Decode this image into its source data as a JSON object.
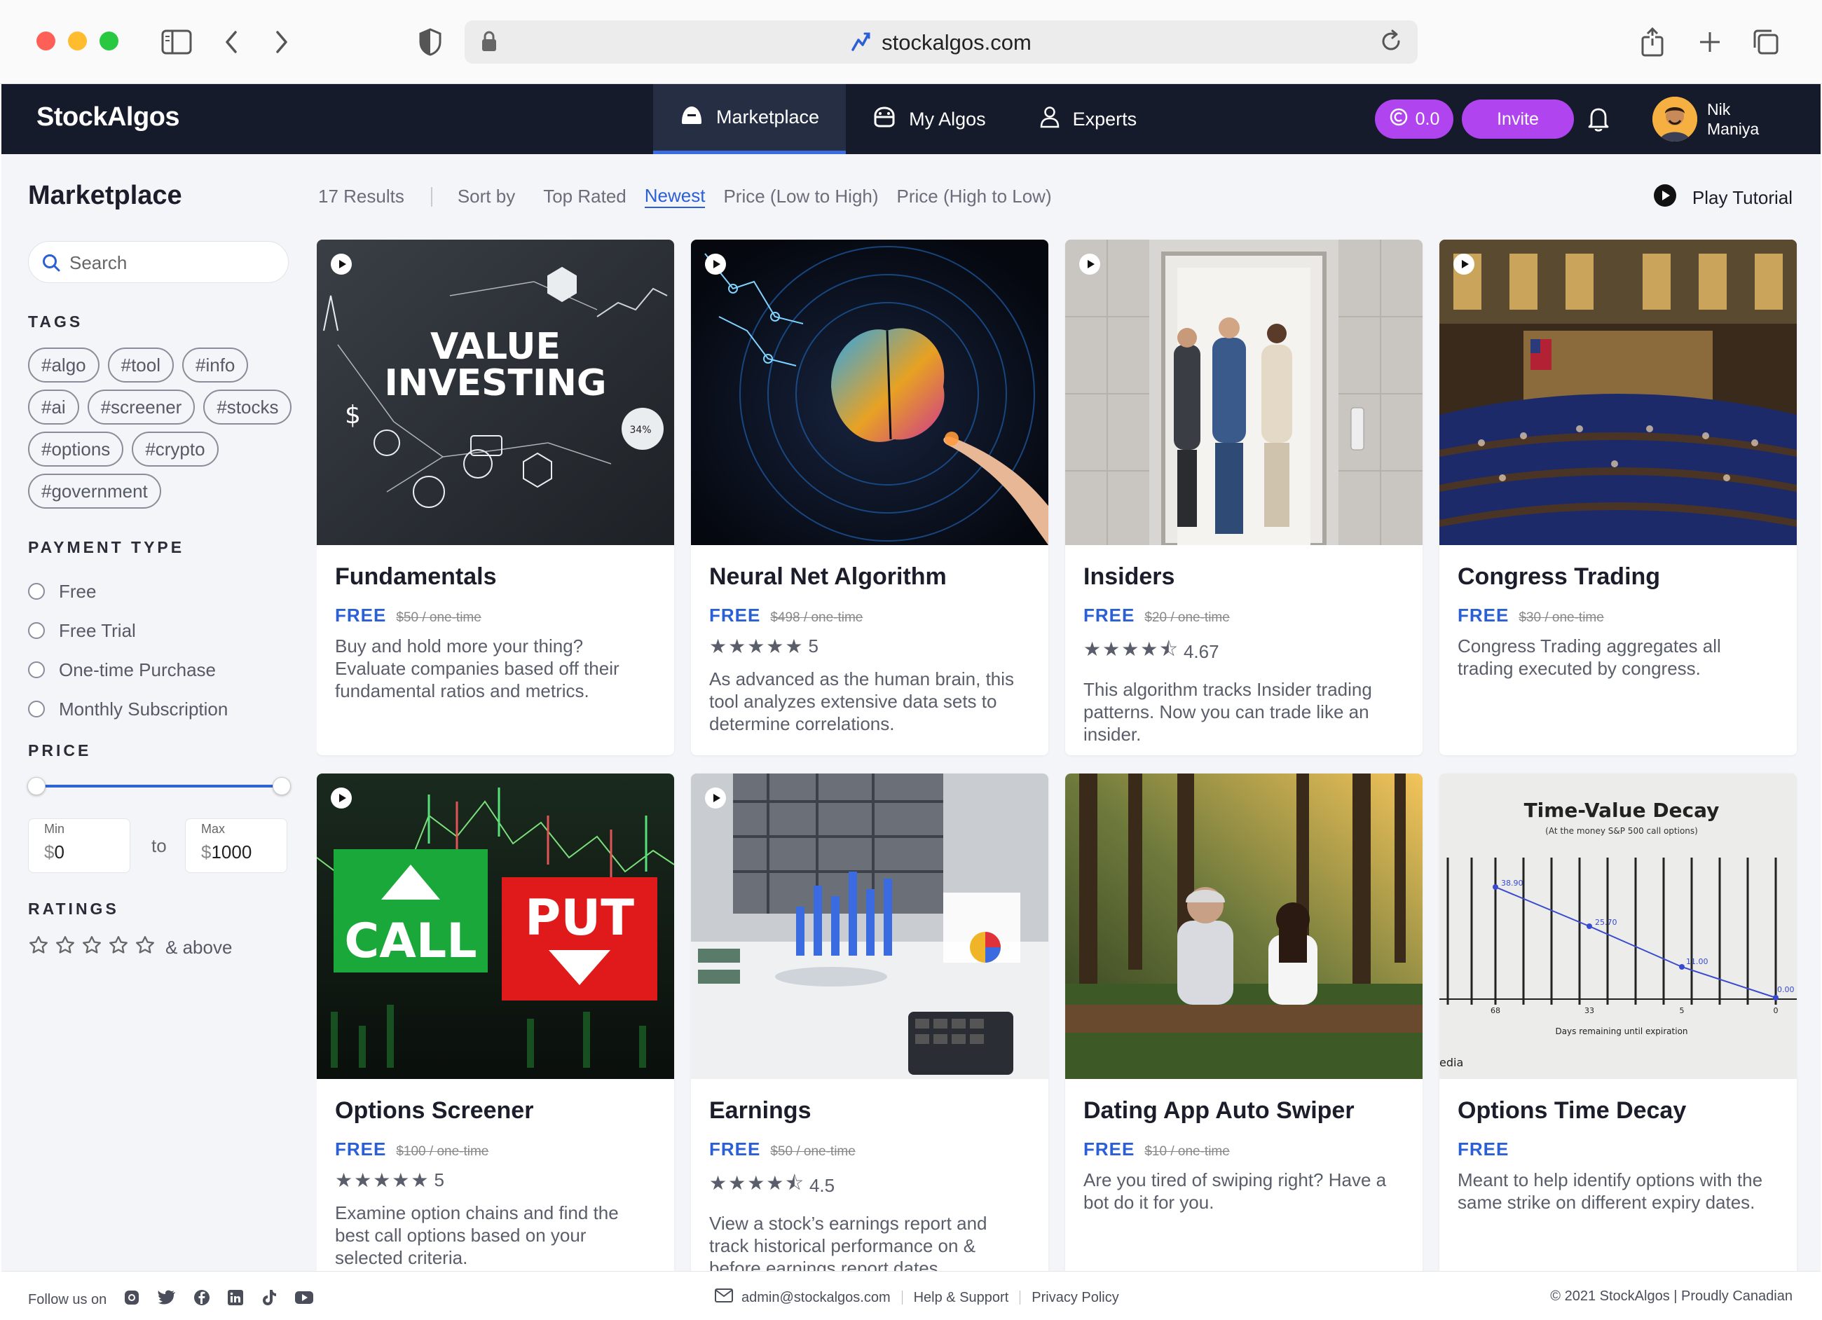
{
  "browser": {
    "url": "stockalgos.com"
  },
  "header": {
    "logo": "StockAlgos",
    "nav": [
      {
        "label": "Marketplace",
        "icon": "marketplace-icon",
        "active": true
      },
      {
        "label": "My Algos",
        "icon": "my-algos-icon",
        "active": false
      },
      {
        "label": "Experts",
        "icon": "user-icon",
        "active": false
      }
    ],
    "credits": "0.0",
    "invite_label": "Invite",
    "user_first": "Nik",
    "user_last": "Maniya"
  },
  "sidebar": {
    "title": "Marketplace",
    "search_placeholder": "Search",
    "tags_label": "TAGS",
    "tags": [
      "#algo",
      "#tool",
      "#info",
      "#ai",
      "#screener",
      "#stocks",
      "#options",
      "#crypto",
      "#government"
    ],
    "payment_label": "PAYMENT TYPE",
    "payment_options": [
      "Free",
      "Free Trial",
      "One-time Purchase",
      "Monthly Subscription"
    ],
    "price_label": "PRICE",
    "price_min_caption": "Min",
    "price_max_caption": "Max",
    "price_currency": "$",
    "price_min": "0",
    "price_max": "1000",
    "price_to": "to",
    "ratings_label": "RATINGS",
    "ratings_suffix": "& above"
  },
  "toolbar": {
    "results": "17 Results",
    "sort_by": "Sort by",
    "sort_options": [
      "Top Rated",
      "Newest",
      "Price (Low to High)",
      "Price (High to Low)"
    ],
    "active_sort": "Newest",
    "tutorial": "Play Tutorial"
  },
  "cards": [
    {
      "title": "Fundamentals",
      "free": "FREE",
      "was": "$50 / one-time",
      "rating": null,
      "rating_text": "",
      "desc": "Buy and hold more your thing? Evaluate companies based off their fundamental ratios and metrics."
    },
    {
      "title": "Neural Net Algorithm",
      "free": "FREE",
      "was": "$498 / one-time",
      "rating": 5,
      "rating_text": "5",
      "desc": "As advanced as the human brain, this tool analyzes extensive data sets to determine correlations."
    },
    {
      "title": "Insiders",
      "free": "FREE",
      "was": "$20 / one-time",
      "rating": 4.67,
      "rating_text": "4.67",
      "desc": "This algorithm tracks Insider trading patterns. Now you can trade like an insider."
    },
    {
      "title": "Congress Trading",
      "free": "FREE",
      "was": "$30 / one-time",
      "rating": null,
      "rating_text": "",
      "desc": "Congress Trading aggregates all trading executed by congress."
    },
    {
      "title": "Options Screener",
      "free": "FREE",
      "was": "$100 / one-time",
      "rating": 5,
      "rating_text": "5",
      "desc": "Examine option chains and find the best call options based on your selected criteria."
    },
    {
      "title": "Earnings",
      "free": "FREE",
      "was": "$50 / one-time",
      "rating": 4.5,
      "rating_text": "4.5",
      "desc": "View a stock’s earnings report and track historical performance on & before earnings report dates."
    },
    {
      "title": "Dating App Auto Swiper",
      "free": "FREE",
      "was": "$10 / one-time",
      "rating": null,
      "rating_text": "",
      "desc": "Are you tired of swiping right? Have a bot do it for you."
    },
    {
      "title": "Options Time Decay",
      "free": "FREE",
      "was": "",
      "rating": null,
      "rating_text": "",
      "desc": "Meant to help identify options with the same strike on different expiry dates."
    }
  ],
  "images": {
    "fundamentals": {
      "line1": "VALUE",
      "line2": "INVESTING",
      "pct": "34%"
    },
    "options_screener": {
      "call": "CALL",
      "put": "PUT"
    },
    "time_decay": {
      "title": "Time-Value Decay",
      "subtitle": "(At the money S&P 500 call options)",
      "points": [
        "38.90",
        "25.70",
        "11.00",
        "0.00"
      ],
      "ticks": [
        "68",
        "33",
        "5",
        "0"
      ],
      "xlabel": "Days remaining until expiration",
      "watermark": "edia"
    }
  },
  "footer": {
    "follow": "Follow us on",
    "email": "admin@stockalgos.com",
    "help": "Help & Support",
    "privacy": "Privacy Policy",
    "copyright": "© 2021 StockAlgos | Proudly Canadian"
  },
  "colors": {
    "accent": "#2b5fd6",
    "purple": "#b045ef",
    "navbar": "#161b2b"
  }
}
